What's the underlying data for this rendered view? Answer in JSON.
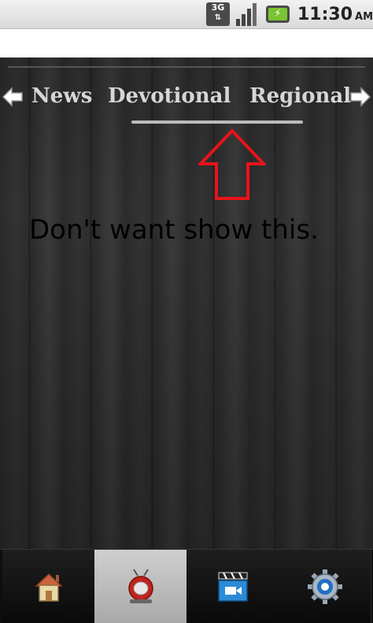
{
  "status_bar": {
    "network_label": "3G",
    "time": "11:30",
    "ampm": "AM",
    "battery_icon": "charging-battery-icon",
    "signal_icon": "signal-strength-icon"
  },
  "tabs": {
    "items": [
      {
        "label": "News"
      },
      {
        "label": "Devotional"
      },
      {
        "label": "Regional"
      }
    ],
    "selected_index": 1,
    "left_arrow_icon": "arrow-left-icon",
    "right_arrow_icon": "arrow-right-icon"
  },
  "annotation": {
    "text": "Don't want show this.",
    "color": "#e8131b"
  },
  "bottom_nav": {
    "items": [
      {
        "icon": "home-icon"
      },
      {
        "icon": "tv-icon"
      },
      {
        "icon": "video-icon"
      },
      {
        "icon": "settings-gear-icon"
      }
    ],
    "selected_index": 1
  },
  "colors": {
    "tab_text": "#d6d6d6",
    "indicator": "#bcbcbc",
    "battery": "#7ac431"
  }
}
